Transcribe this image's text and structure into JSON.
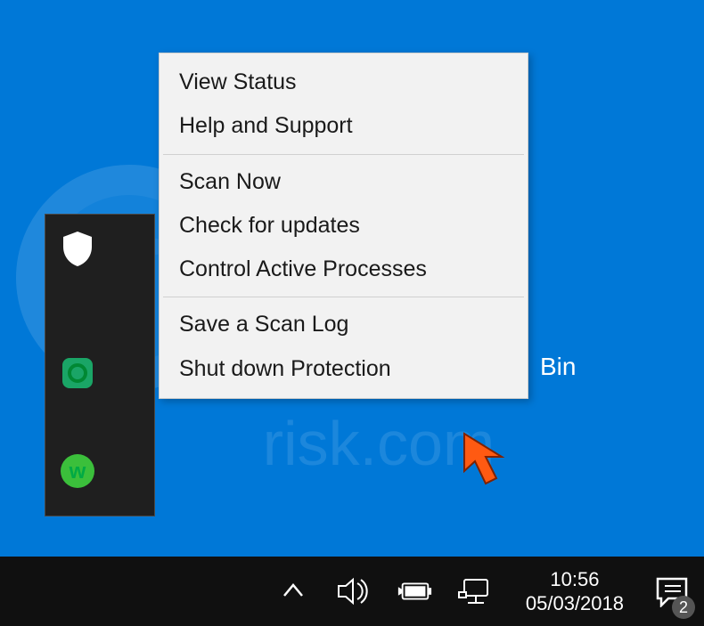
{
  "menu": {
    "items": [
      "View Status",
      "Help and Support",
      "Scan Now",
      "Check for updates",
      "Control Active Processes",
      "Save a Scan Log",
      "Shut down Protection"
    ]
  },
  "desktop": {
    "recycle_bin_label_fragment": "Bin"
  },
  "taskbar": {
    "clock_time": "10:56",
    "clock_date": "05/03/2018",
    "action_center_badge": "2"
  }
}
